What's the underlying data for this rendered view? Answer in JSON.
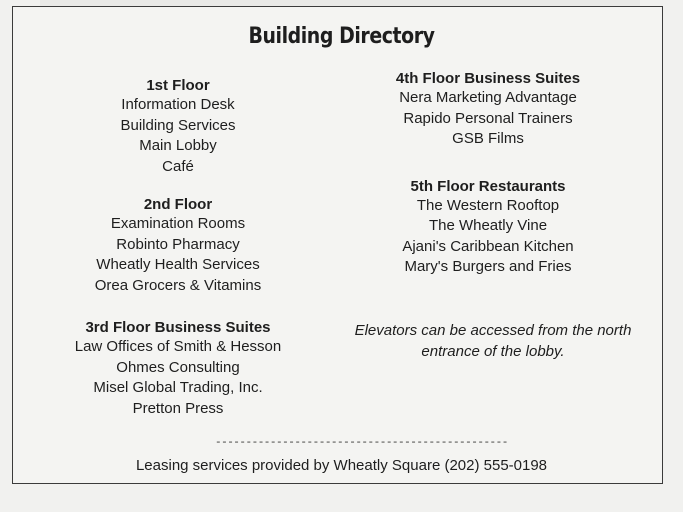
{
  "title": "Building Directory",
  "left": {
    "floor1": {
      "heading": "1st Floor",
      "items": [
        "Information Desk",
        "Building Services",
        "Main Lobby",
        "Café"
      ]
    },
    "floor2": {
      "heading": "2nd Floor",
      "items": [
        "Examination Rooms",
        "Robinto Pharmacy",
        "Wheatly Health Services",
        "Orea Grocers & Vitamins"
      ]
    },
    "floor3": {
      "heading": "3rd Floor Business Suites",
      "items": [
        "Law Offices of Smith & Hesson",
        "Ohmes Consulting",
        "Misel Global Trading, Inc.",
        "Pretton Press"
      ]
    }
  },
  "right": {
    "floor4": {
      "heading": "4th Floor Business Suites",
      "items": [
        "Nera Marketing Advantage",
        "Rapido Personal Trainers",
        "GSB Films"
      ]
    },
    "floor5": {
      "heading": "5th Floor Restaurants",
      "items": [
        "The Western Rooftop",
        "The Wheatly Vine",
        "Ajani's Caribbean Kitchen",
        "Mary's Burgers and Fries"
      ]
    },
    "note": "Elevators can be accessed from the north entrance of the lobby."
  },
  "divider": "------------------------------------------------",
  "footer": "Leasing services provided by Wheatly Square (202) 555-0198"
}
